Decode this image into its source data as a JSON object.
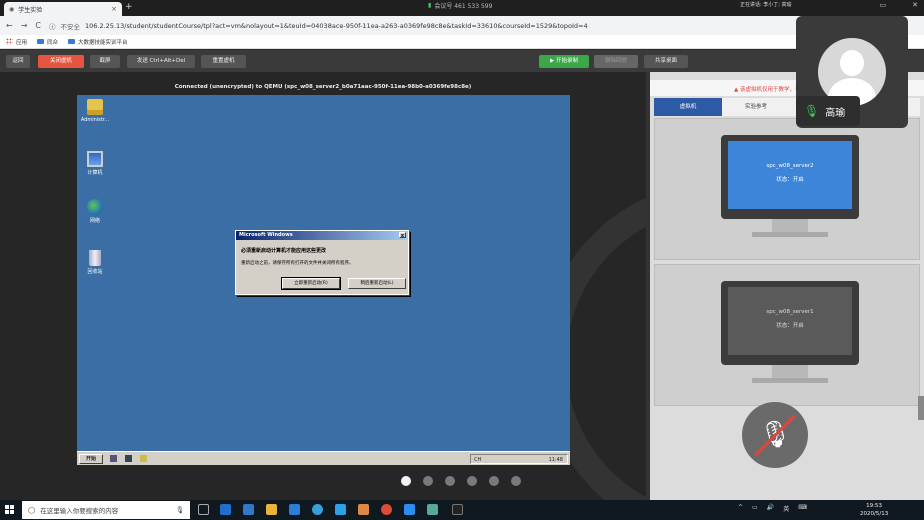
{
  "browser": {
    "tab_title": "学生实验",
    "tab_close": "×",
    "new_tab": "+",
    "insecure_label": "不安全",
    "url": "106.2.25.13/student/studentCourse/tpl?act=vm&nolayout=1&teuId=04038ace-950f-11ea-a263-a0369fe98c8e&taskId=33610&courseId=1529&topoId=4",
    "meeting_label": "会议号 461 533 599",
    "host_note": "正在讲话: 李小丁; 高瑜",
    "bookmarks": [
      "应用",
      "同众",
      "大数据技能实训平台"
    ]
  },
  "toolbar": {
    "back": "返回",
    "close_vm": "关闭虚机",
    "screenshot": "截屏",
    "send_cad": "发送 Ctrl+Alt+Del",
    "restart_vm": "重置虚机",
    "start_record": "▶ 开始录制",
    "delete_record": "删除回放",
    "share_desktop": "共享桌面"
  },
  "vnc": {
    "status": "Connected (unencrypted) to QEMU (spc_w08_server2_b0a71aac-950f-11ea-98b0-a0369fe98c8e)"
  },
  "vm_desktop": {
    "icons": [
      "Administr...",
      "计算机",
      "网络",
      "回收站"
    ],
    "dialog": {
      "title": "Microsoft Windows",
      "message": "必须重新启动计算机才能应用这些更改",
      "detail": "重新启动之前，请保存所有打开的文件并关闭所有程序。",
      "restart_now": "立即重新启动(R)",
      "restart_later": "稍后重新启动(L)"
    },
    "taskbar": {
      "start": "开始",
      "lang": "CH",
      "time": "11:48"
    }
  },
  "pager": {
    "count": 6,
    "active": 0
  },
  "right_panel": {
    "warning": "▲ 该虚拟机仅用于教学，请...",
    "tabs": [
      "虚拟机",
      "实验参考"
    ],
    "vms": [
      {
        "name": "spc_w08_server2",
        "status": "状态：开启",
        "active": true
      },
      {
        "name": "spc_w08_server1",
        "status": "状态：开启",
        "active": false
      }
    ]
  },
  "video": {
    "speaker_name": "高瑜"
  },
  "windows_taskbar": {
    "search_placeholder": "在这里输入你要搜索的内容",
    "tray_items": [
      "^",
      "▭",
      "🔊",
      "英",
      "⌨"
    ],
    "time": "19:53",
    "date": "2020/5/13"
  }
}
